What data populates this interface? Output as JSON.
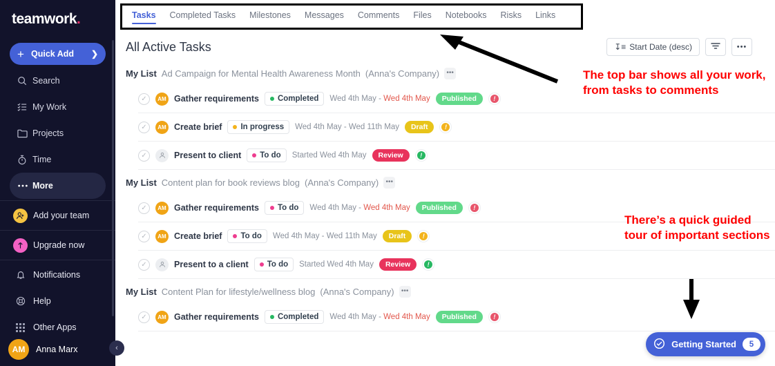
{
  "sidebar": {
    "brand": "teamwork",
    "brand_dot": ".",
    "quick_add": {
      "label": "Quick Add",
      "plus": "+",
      "chevron": "❯"
    },
    "nav": [
      {
        "label": "Search",
        "icon": "search-icon"
      },
      {
        "label": "My Work",
        "icon": "list-check-icon"
      },
      {
        "label": "Projects",
        "icon": "folder-icon"
      },
      {
        "label": "Time",
        "icon": "stopwatch-icon"
      },
      {
        "label": "More",
        "icon": "ellipsis-icon",
        "active": true
      }
    ],
    "promos": [
      {
        "label": "Add your team",
        "icon": "add-person-icon",
        "color": "#f5c342"
      },
      {
        "label": "Upgrade now",
        "icon": "up-arrow-icon",
        "color": "#f361c4"
      }
    ],
    "secondary": [
      {
        "label": "Notifications",
        "icon": "bell-icon"
      },
      {
        "label": "Help",
        "icon": "lifebuoy-icon"
      },
      {
        "label": "Other Apps",
        "icon": "grid-apps-icon"
      }
    ],
    "user": {
      "initials": "AM",
      "name": "Anna Marx"
    },
    "collapse": "‹"
  },
  "topbar": {
    "tabs": [
      {
        "label": "Tasks",
        "active": true
      },
      {
        "label": "Completed Tasks",
        "active": false
      },
      {
        "label": "Milestones",
        "active": false
      },
      {
        "label": "Messages",
        "active": false
      },
      {
        "label": "Comments",
        "active": false
      },
      {
        "label": "Files",
        "active": false
      },
      {
        "label": "Notebooks",
        "active": false
      },
      {
        "label": "Risks",
        "active": false
      },
      {
        "label": "Links",
        "active": false
      }
    ]
  },
  "header": {
    "title": "All Active Tasks",
    "sort_button": "Start Date (desc)",
    "sort_icon": "↧≡",
    "filter_icon": "filter-icon",
    "more_icon": "•••"
  },
  "groups": [
    {
      "mylist": "My List",
      "name": "Ad Campaign for Mental Health Awareness Month",
      "company": "(Anna's Company)",
      "menu": "•••",
      "tasks": [
        {
          "initials": "AM",
          "has_avatar": true,
          "name": "Gather requirements",
          "status": "Completed",
          "status_dot": "#27b862",
          "date_start": "Wed 4th May - ",
          "date_due": "Wed 4th May",
          "tag": "Published",
          "tag_color": "#62d98a",
          "priority_color": "#e8556b",
          "priority_mark": "!"
        },
        {
          "initials": "AM",
          "has_avatar": true,
          "name": "Create brief",
          "status": "In progress",
          "status_dot": "#f3b31c",
          "date_start": "Wed 4th May - Wed 11th May",
          "date_due": "",
          "tag": "Draft",
          "tag_color": "#e8c41a",
          "priority_color": "#f3b31c",
          "priority_mark": "!"
        },
        {
          "initials": "",
          "has_avatar": false,
          "name": "Present to client",
          "status": "To do",
          "status_dot": "#ee3d8f",
          "date_start": "Started Wed 4th May",
          "date_due": "",
          "tag": "Review",
          "tag_color": "#e8335c",
          "priority_color": "#27b862",
          "priority_mark": "!"
        }
      ]
    },
    {
      "mylist": "My List",
      "name": "Content plan for book reviews blog",
      "company": "(Anna's Company)",
      "menu": "•••",
      "tasks": [
        {
          "initials": "AM",
          "has_avatar": true,
          "name": "Gather requirements",
          "status": "To do",
          "status_dot": "#ee3d8f",
          "date_start": "Wed 4th May - ",
          "date_due": "Wed 4th May",
          "tag": "Published",
          "tag_color": "#62d98a",
          "priority_color": "#e8556b",
          "priority_mark": "!"
        },
        {
          "initials": "AM",
          "has_avatar": true,
          "name": "Create brief",
          "status": "To do",
          "status_dot": "#ee3d8f",
          "date_start": "Wed 4th May - Wed 11th May",
          "date_due": "",
          "tag": "Draft",
          "tag_color": "#e8c41a",
          "priority_color": "#f3b31c",
          "priority_mark": "!"
        },
        {
          "initials": "",
          "has_avatar": false,
          "name": "Present to a client",
          "status": "To do",
          "status_dot": "#ee3d8f",
          "date_start": "Started Wed 4th May",
          "date_due": "",
          "tag": "Review",
          "tag_color": "#e8335c",
          "priority_color": "#27b862",
          "priority_mark": "!"
        }
      ]
    },
    {
      "mylist": "My List",
      "name": "Content Plan for lifestyle/wellness blog",
      "company": "(Anna's Company)",
      "menu": "•••",
      "tasks": [
        {
          "initials": "AM",
          "has_avatar": true,
          "name": "Gather requirements",
          "status": "Completed",
          "status_dot": "#27b862",
          "date_start": "Wed 4th May - ",
          "date_due": "Wed 4th May",
          "tag": "Published",
          "tag_color": "#62d98a",
          "priority_color": "#e8556b",
          "priority_mark": "!"
        }
      ]
    }
  ],
  "annotations": {
    "color": "#fe0000",
    "note_1": "The top bar shows all your work, from tasks to comments",
    "note_2": "There’s a quick guided tour of important sections"
  },
  "getting_started": {
    "label": "Getting Started",
    "count": "5",
    "icon": "check-circle-icon"
  }
}
